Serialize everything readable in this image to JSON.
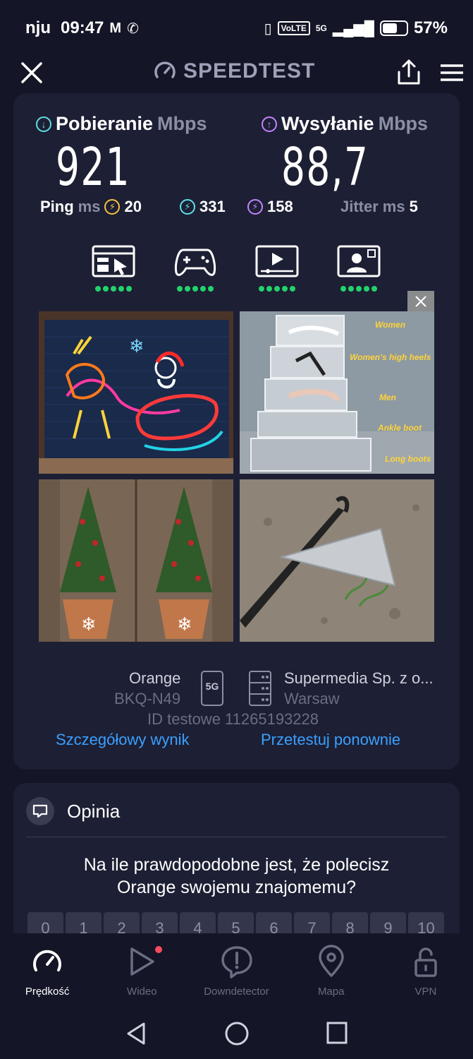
{
  "status": {
    "carrier": "nju",
    "time": "09:47",
    "volte": "VoLTE",
    "network": "5G",
    "battery": "57%",
    "battery_level": 0.57
  },
  "header": {
    "title": "SPEEDTEST"
  },
  "results": {
    "download": {
      "label": "Pobieranie",
      "unit": "Mbps",
      "value": "921"
    },
    "upload": {
      "label": "Wysyłanie",
      "unit": "Mbps",
      "value": "88,7"
    },
    "ping": {
      "label": "Ping",
      "unit": "ms",
      "value": "20"
    },
    "ping_download": "331",
    "ping_upload": "158",
    "jitter": {
      "label": "Jitter",
      "unit": "ms",
      "value": "5"
    }
  },
  "quality": {
    "icons": [
      "browsing-icon",
      "gaming-icon",
      "video-streaming-icon",
      "video-call-icon"
    ],
    "levels": [
      5,
      5,
      5,
      5
    ]
  },
  "ad": {
    "tiles": [
      {
        "label": ""
      },
      {
        "labels": [
          "Women",
          "Women's high heels",
          "Men",
          "Ankle boot",
          "Long boots"
        ]
      },
      {
        "label": ""
      },
      {
        "label": ""
      }
    ]
  },
  "server_info": {
    "provider": "Orange",
    "device": "BKQ-N49",
    "network_badge": "5G",
    "host": "Supermedia Sp. z o...",
    "city": "Warsaw",
    "test_id": "ID testowe 11265193228",
    "detail_link": "Szczegółowy wynik",
    "retest_link": "Przetestuj ponownie"
  },
  "opinion": {
    "title": "Opinia",
    "question_line1": "Na ile prawdopodobne jest, że polecisz",
    "question_line2": "Orange swojemu znajomemu?",
    "scale": [
      "0",
      "1",
      "2",
      "3",
      "4",
      "5",
      "6",
      "7",
      "8",
      "9",
      "10"
    ]
  },
  "nav": {
    "items": [
      {
        "label": "Prędkość",
        "icon": "speedometer-icon"
      },
      {
        "label": "Wideo",
        "icon": "play-icon"
      },
      {
        "label": "Downdetector",
        "icon": "alert-icon"
      },
      {
        "label": "Mapa",
        "icon": "map-pin-icon"
      },
      {
        "label": "VPN",
        "icon": "lock-icon"
      }
    ]
  },
  "colors": {
    "background": "#141526",
    "card": "#1d1f34",
    "download": "#5de0e6",
    "upload": "#c285ff",
    "link": "#3aa0ff",
    "quality_dot": "#22d36b",
    "ping_coin": "#f5c242"
  }
}
